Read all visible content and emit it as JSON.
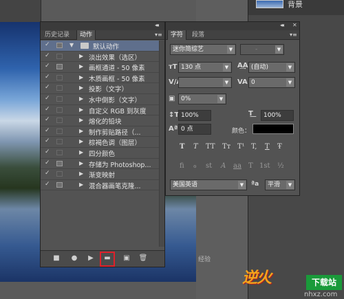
{
  "workspace": {
    "layer_name": "背景"
  },
  "actions_panel": {
    "tabs": [
      "历史记录",
      "动作"
    ],
    "active_tab": "动作",
    "collapse_icon": "double-chevron-left-icon",
    "close_icon": "close-icon",
    "menu_icon": "panel-menu-icon",
    "set_name": "默认动作",
    "actions": [
      "淡出效果（选区）",
      "画框通道 - 50 像素",
      "木质画框 - 50 像素",
      "投影（文字）",
      "水中倒影（文字）",
      "自定义 RGB 到灰度",
      "熔化的铅块",
      "制作剪贴路径（...",
      "棕褐色调（图层）",
      "四分颜色",
      "存储为 Photoshop...",
      "渐变映射",
      "混合器画笔克隆..."
    ],
    "bottom_buttons": [
      "stop-icon",
      "record-icon",
      "play-icon",
      "new-set-icon",
      "new-action-icon",
      "delete-icon"
    ],
    "highlight_color": "#e0202a"
  },
  "character_panel": {
    "tabs": [
      "字符",
      "段落"
    ],
    "active_tab": "字符",
    "font_family": "迷你简综艺",
    "font_style": "-",
    "font_size": "130 点",
    "leading": "(自动)",
    "kerning": "",
    "tracking": "0",
    "tsume": "0%",
    "vertical_scale": "100%",
    "horizontal_scale": "100%",
    "baseline_shift": "0 点",
    "color_label": "颜色：",
    "color_value": "#000000",
    "style_buttons": [
      "T",
      "T",
      "TT",
      "Tт",
      "T¹",
      "T,",
      "T",
      "Ŧ"
    ],
    "opentype_buttons": [
      "fi",
      "ℴ",
      "st",
      "A",
      "aa",
      "T",
      "1st",
      "½"
    ],
    "language": "美国英语",
    "aa_label": "ªa",
    "anti_alias": "平滑"
  },
  "watermark": {
    "logo_text": "逆火",
    "badge_text": "下载站",
    "url": "nhxz.com",
    "tutorial_text": "经验"
  }
}
